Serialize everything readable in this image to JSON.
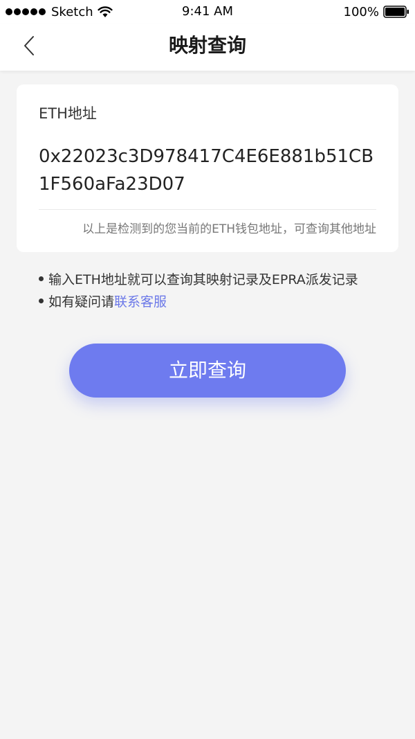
{
  "status_bar": {
    "carrier": "Sketch",
    "time": "9:41 AM",
    "battery": "100%"
  },
  "nav": {
    "title": "映射查询"
  },
  "card": {
    "label": "ETH地址",
    "address": "0x22023c3D978417C4E6E881b51CB1F560aFa23D07",
    "hint": "以上是检测到的您当前的ETH钱包地址，可查询其他地址"
  },
  "notes": {
    "item1": "输入ETH地址就可以查询其映射记录及EPRA派发记录",
    "item2_prefix": "如有疑问请",
    "item2_link": "联系客服"
  },
  "actions": {
    "query_label": "立即查询"
  },
  "colors": {
    "accent": "#6e7bef",
    "link": "#6b78e8",
    "background": "#f4f4f4"
  }
}
